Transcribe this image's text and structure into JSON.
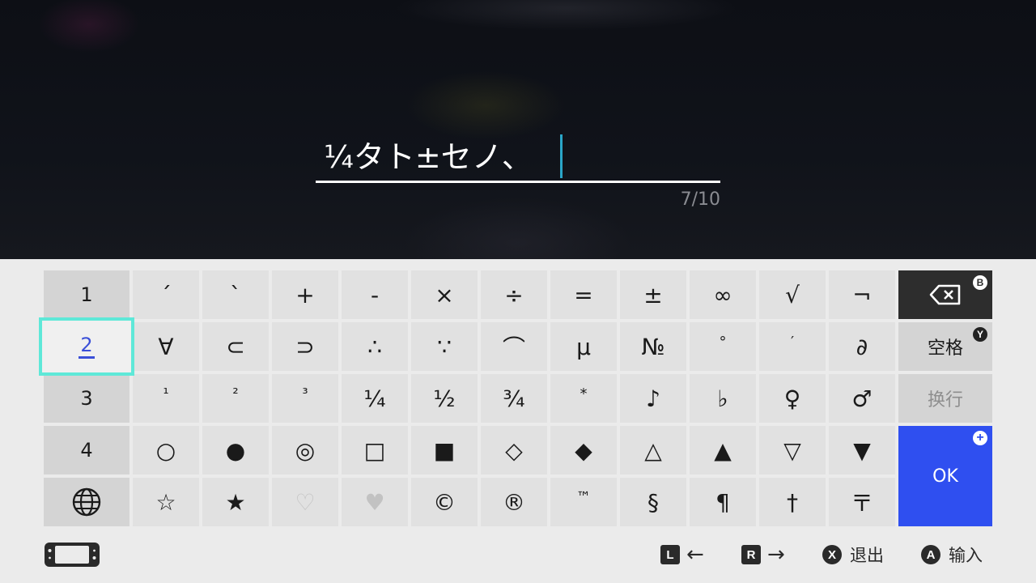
{
  "input": {
    "text": "¼タト±セノ、",
    "counter": "7/10"
  },
  "tabs": [
    {
      "label": "1"
    },
    {
      "label": "2"
    },
    {
      "label": "3"
    },
    {
      "label": "4"
    },
    {
      "icon": "globe-icon"
    }
  ],
  "rows": [
    [
      "´",
      "`",
      "+",
      "-",
      "×",
      "÷",
      "=",
      "±",
      "∞",
      "√",
      "¬"
    ],
    [
      "∀",
      "⊂",
      "⊃",
      "∴",
      "∵",
      "⌒",
      "µ",
      "№",
      "°",
      "′",
      "∂"
    ],
    [
      "¹",
      "²",
      "³",
      "¼",
      "½",
      "¾",
      "*",
      "♪",
      "♭",
      "♀",
      "♂"
    ],
    [
      "○",
      "●",
      "◎",
      "□",
      "■",
      "◇",
      "◆",
      "△",
      "▲",
      "▽",
      "▼"
    ],
    [
      "☆",
      "★",
      "♡",
      "♥",
      "©",
      "®",
      "™",
      "§",
      "¶",
      "†",
      "〒"
    ]
  ],
  "actions": {
    "backspace": {
      "icon": "backspace-icon",
      "badge": "B"
    },
    "space": {
      "label": "空格",
      "badge": "Y"
    },
    "newline": {
      "label": "换行"
    },
    "ok": {
      "label": "OK",
      "badge": "+"
    }
  },
  "footer": {
    "hints": [
      {
        "key": "L",
        "label": "←"
      },
      {
        "key": "R",
        "label": "→"
      },
      {
        "key": "X",
        "label": "退出"
      },
      {
        "key": "A",
        "label": "输入"
      }
    ]
  },
  "colors": {
    "accent": "#2f4ff0",
    "selection": "#5ee8d8",
    "caret": "#2aa6c8"
  }
}
